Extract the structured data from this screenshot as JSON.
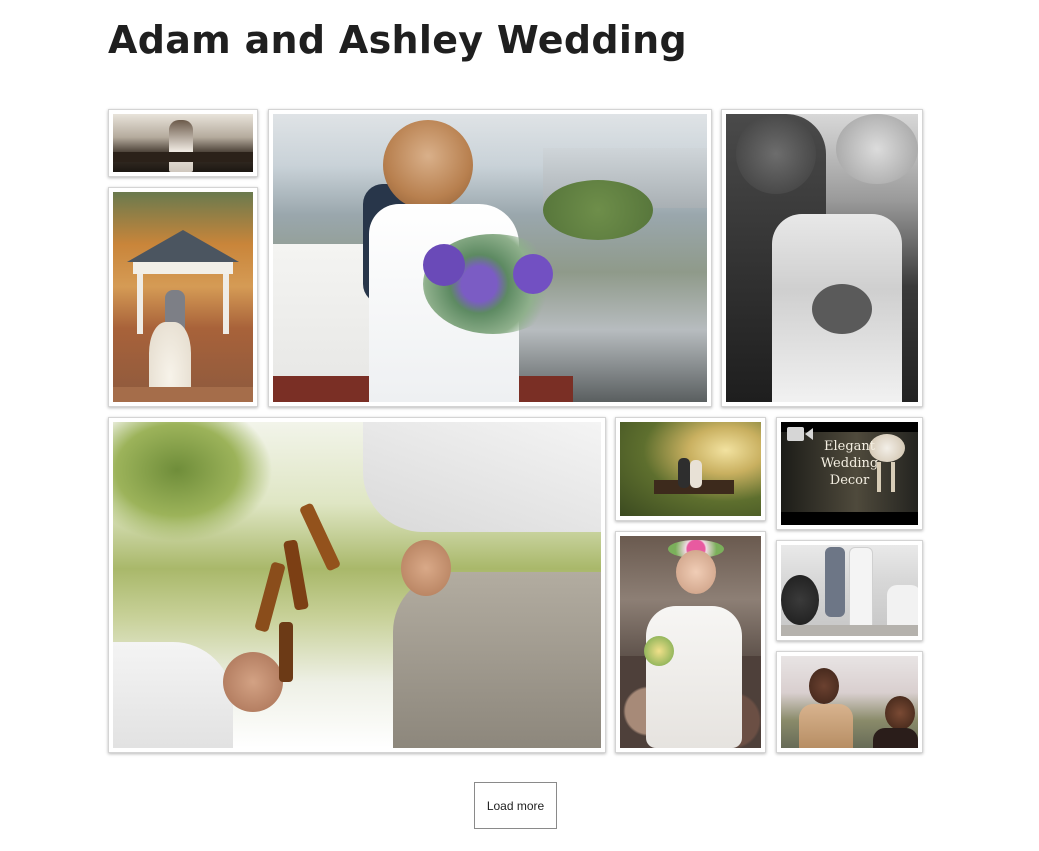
{
  "page": {
    "title": "Adam and Ashley Wedding"
  },
  "gallery": {
    "video_tile": {
      "icon": "video-camera-icon",
      "caption": "Elegant\nWedding\nDecor"
    },
    "load_more_label": "Load more"
  }
}
